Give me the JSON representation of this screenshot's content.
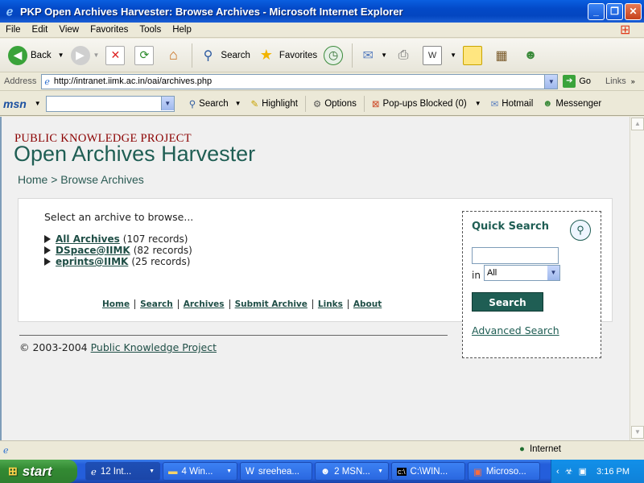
{
  "window": {
    "title": "PKP Open Archives Harvester: Browse Archives - Microsoft Internet Explorer"
  },
  "menu": [
    "File",
    "Edit",
    "View",
    "Favorites",
    "Tools",
    "Help"
  ],
  "toolbar": {
    "back": "Back",
    "search": "Search",
    "favorites": "Favorites"
  },
  "address": {
    "label": "Address",
    "url": "http://intranet.iimk.ac.in/oai/archives.php",
    "go": "Go",
    "links": "Links"
  },
  "msnbar": {
    "logo": "msn",
    "search": "Search",
    "highlight": "Highlight",
    "options": "Options",
    "popups": "Pop-ups Blocked (0)",
    "hotmail": "Hotmail",
    "messenger": "Messenger"
  },
  "page": {
    "org": "PUBLIC KNOWLEDGE PROJECT",
    "app_title": "Open Archives Harvester",
    "breadcrumb": "Home > Browse Archives",
    "prompt": "Select an archive to browse...",
    "archives": [
      {
        "name": "All Archives",
        "count": "(107 records)"
      },
      {
        "name": "DSpace@IIMK",
        "count": "(82 records)"
      },
      {
        "name": "eprints@IIMK",
        "count": "(25 records)"
      }
    ],
    "footer_nav": [
      "Home",
      "Search",
      "Archives",
      "Submit Archive",
      "Links",
      "About"
    ],
    "copyright_prefix": "© 2003-2004",
    "copyright_link": "Public Knowledge Project"
  },
  "quick_search": {
    "title": "Quick Search",
    "in_label": "in",
    "scope_selected": "All",
    "button": "Search",
    "advanced": "Advanced Search"
  },
  "status": {
    "zone": "Internet"
  },
  "taskbar": {
    "start": "start",
    "tasks": [
      "12 Int...",
      "4 Win...",
      "sreehea...",
      "2 MSN...",
      "C:\\WIN...",
      "Microso..."
    ],
    "clock": "3:16 PM"
  }
}
